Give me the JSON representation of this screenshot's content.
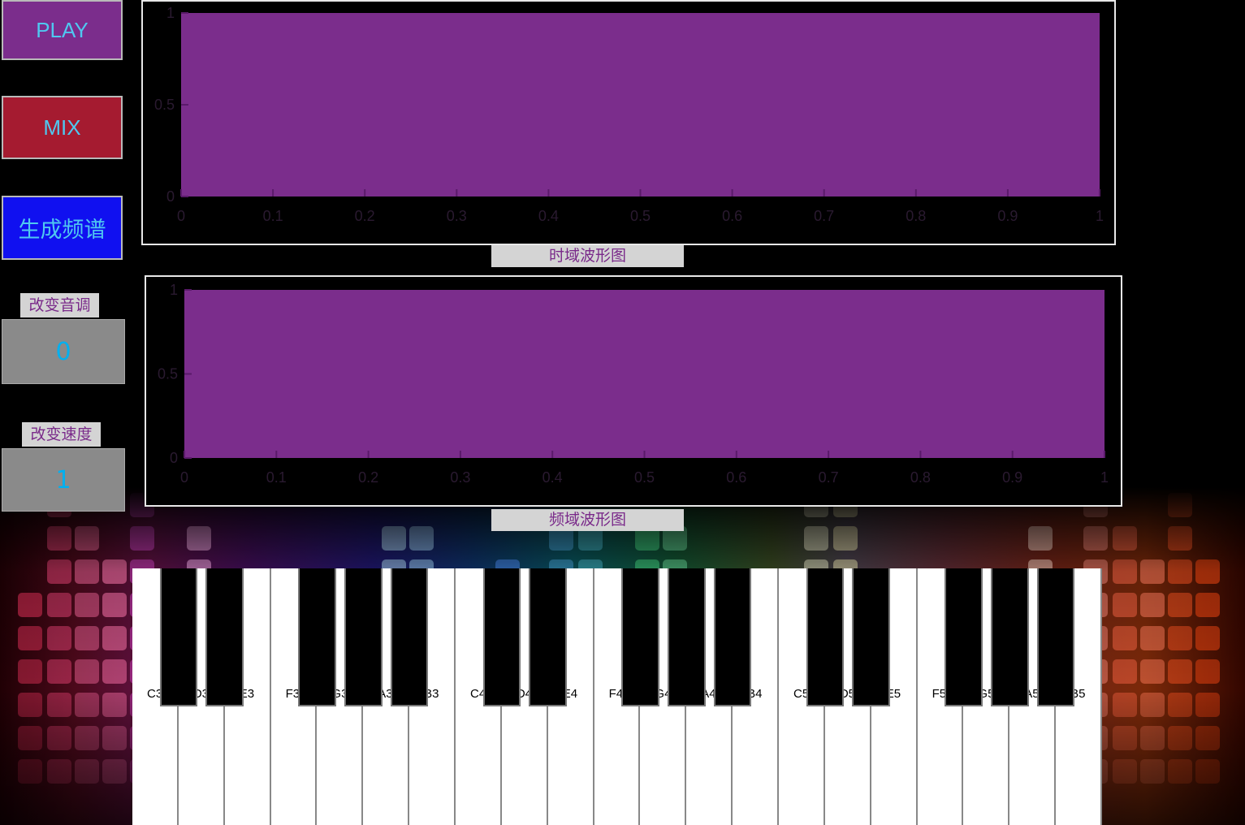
{
  "buttons": {
    "play": {
      "label": "PLAY",
      "bg": "#7b2d8c",
      "fg": "#4fc8f0"
    },
    "mix": {
      "label": "MIX",
      "bg": "#a51b30",
      "fg": "#4fc8f0"
    },
    "spectrum": {
      "label": "生成频谱",
      "bg": "#1010f0",
      "fg": "#4fc8f0"
    }
  },
  "pitch": {
    "label": "改变音调",
    "value": "0"
  },
  "speed": {
    "label": "改变速度",
    "value": "1"
  },
  "time_plot": {
    "caption": "时域波形图",
    "fill_color": "#7b2d8c",
    "xticks": [
      "0",
      "0.1",
      "0.2",
      "0.3",
      "0.4",
      "0.5",
      "0.6",
      "0.7",
      "0.8",
      "0.9",
      "1"
    ],
    "yticks": [
      "0",
      "0.5",
      "1"
    ]
  },
  "freq_plot": {
    "caption": "频域波形图",
    "fill_color": "#7b2d8c",
    "xticks": [
      "0",
      "0.1",
      "0.2",
      "0.3",
      "0.4",
      "0.5",
      "0.6",
      "0.7",
      "0.8",
      "0.9",
      "1"
    ],
    "yticks": [
      "0",
      "0.5",
      "1"
    ]
  },
  "piano": {
    "white_key_labels": [
      "C3",
      "D3",
      "E3",
      "F3",
      "G3",
      "A3",
      "B3",
      "C4",
      "D4",
      "E4",
      "F4",
      "G4",
      "A4",
      "B4",
      "C5",
      "D5",
      "E5",
      "F5",
      "G5",
      "A5",
      "B5"
    ]
  }
}
